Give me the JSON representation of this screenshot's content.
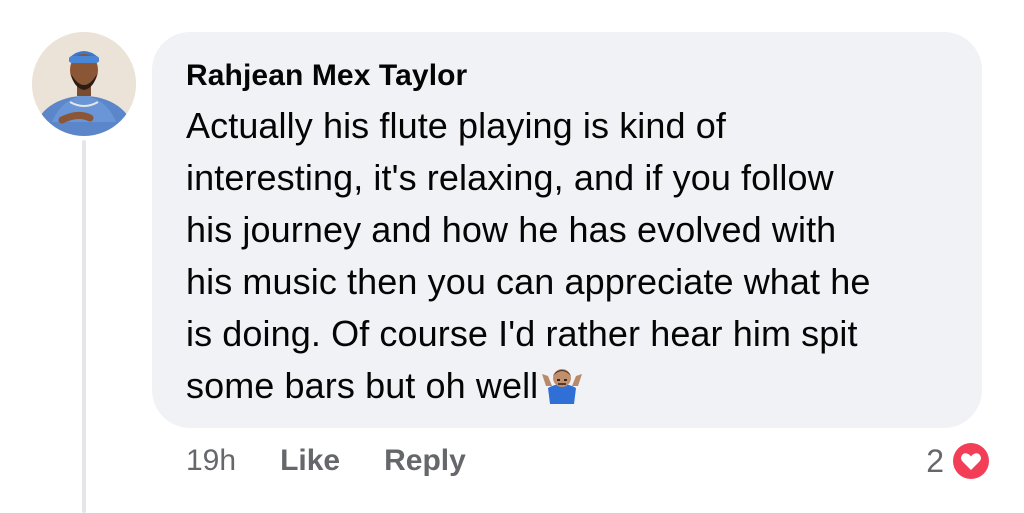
{
  "comment": {
    "author": "Rahjean Mex Taylor",
    "lines": [
      "Actually his flute playing is kind of",
      "interesting, it's relaxing, and if you follow",
      "his journey and how he has evolved with",
      "his music then you can appreciate what he",
      "is doing. Of course I'd rather hear him spit",
      "some bars but oh well"
    ],
    "trailing_emoji": "person-shrugging-emoji",
    "timestamp": "19h",
    "like_label": "Like",
    "reply_label": "Reply",
    "reaction_count": "2",
    "reaction_icon": "heart-reaction-icon"
  },
  "colors": {
    "bubble": "#f0f2f5",
    "text": "#050505",
    "secondary_text": "#65676b",
    "heart": "#f33e58"
  }
}
